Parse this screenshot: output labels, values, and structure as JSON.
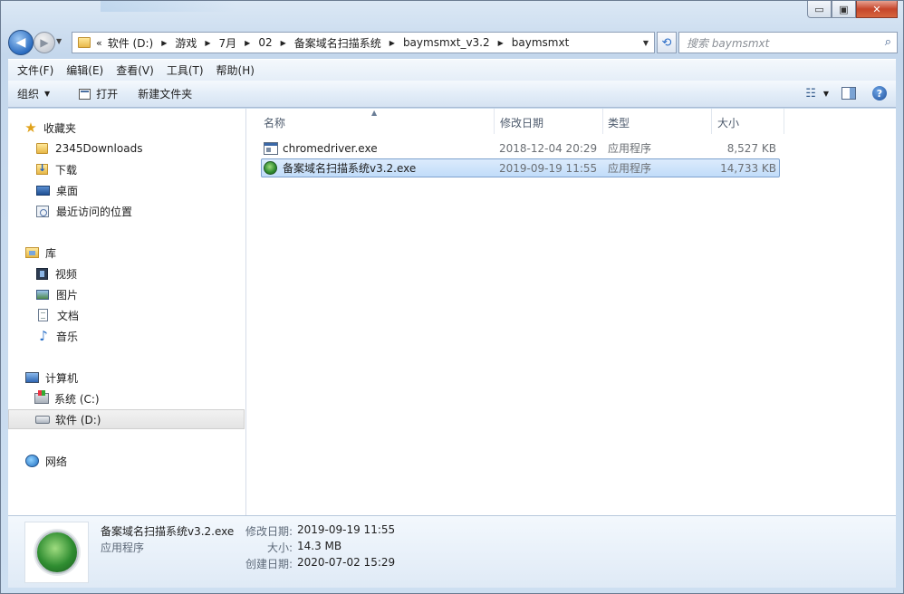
{
  "window": {
    "minimize_label": "▭",
    "restore_label": "▣",
    "close_label": "✕"
  },
  "nav": {
    "back_label": "◀",
    "forward_label": "▶",
    "dropdown_label": "▼"
  },
  "address": {
    "overflow": "«",
    "crumbs": [
      "软件 (D:)",
      "游戏",
      "7月",
      "02",
      "备案域名扫描系统",
      "baymsmxt_v3.2",
      "baymsmxt"
    ],
    "separator": "▶",
    "dropdown": "▼"
  },
  "refresh_label": "⟲",
  "search": {
    "placeholder": "搜索 baymsmxt",
    "icon_glyph": "⌕"
  },
  "menubar": {
    "items": [
      "文件(F)",
      "编辑(E)",
      "查看(V)",
      "工具(T)",
      "帮助(H)"
    ]
  },
  "toolbar": {
    "organize": "组织",
    "open": "打开",
    "new_folder": "新建文件夹",
    "view_glyph": "☷",
    "help_glyph": "?"
  },
  "sidebar": {
    "favorites": {
      "title": "收藏夹",
      "items": [
        "2345Downloads",
        "下载",
        "桌面",
        "最近访问的位置"
      ]
    },
    "libraries": {
      "title": "库",
      "items": [
        "视频",
        "图片",
        "文档",
        "音乐"
      ]
    },
    "computer": {
      "title": "计算机",
      "items": [
        "系统 (C:)",
        "软件 (D:)"
      ]
    },
    "network": {
      "title": "网络"
    }
  },
  "file_list": {
    "sort_glyph": "▲",
    "headers": [
      "名称",
      "修改日期",
      "类型",
      "大小"
    ],
    "rows": [
      {
        "name": "chromedriver.exe",
        "modified": "2018-12-04 20:29",
        "type": "应用程序",
        "size": "8,527 KB"
      },
      {
        "name": "备案域名扫描系统v3.2.exe",
        "modified": "2019-09-19 11:55",
        "type": "应用程序",
        "size": "14,733 KB"
      }
    ],
    "selected_index": 1
  },
  "details": {
    "filename": "备案域名扫描系统v3.2.exe",
    "type": "应用程序",
    "modified_label": "修改日期:",
    "modified_value": "2019-09-19 11:55",
    "size_label": "大小:",
    "size_value": "14.3 MB",
    "created_label": "创建日期:",
    "created_value": "2020-07-02 15:29"
  },
  "colors": {
    "selection": "#cde3fb",
    "chrome": "#c4d7ec"
  }
}
